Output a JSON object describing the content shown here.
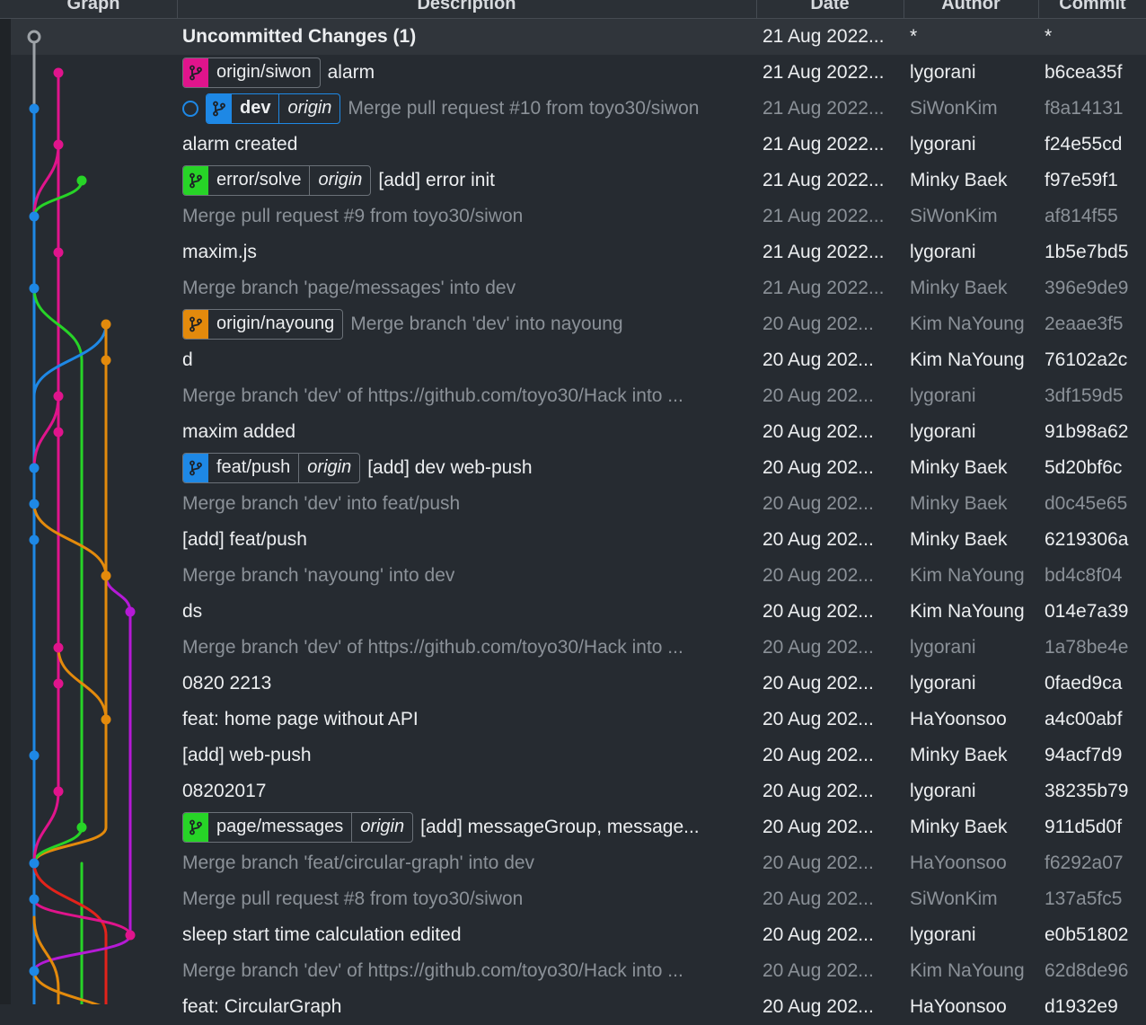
{
  "header": {
    "graph": "Graph",
    "description": "Description",
    "date": "Date",
    "author": "Author",
    "commit": "Commit"
  },
  "colors": {
    "blue": "#1e88e5",
    "magenta": "#e0148c",
    "green": "#27d427",
    "orange": "#e38a0c",
    "purple": "#b51ad6",
    "red": "#e3231b",
    "gray": "#9ea3a8"
  },
  "icons": {
    "branch": "branch-icon",
    "head_indicator": "head-indicator-icon"
  },
  "rows": [
    {
      "description": "Uncommitted Changes (1)",
      "date": "21 Aug 2022...",
      "author": "*",
      "commit": "*"
    },
    {
      "description": "alarm",
      "date": "21 Aug 2022...",
      "author": "lygorani",
      "commit": "b6cea35f",
      "tag": {
        "name": "origin/siwon",
        "color": "#e0148c"
      }
    },
    {
      "description": "Merge pull request #10 from toyo30/siwon",
      "date": "21 Aug 2022...",
      "author": "SiWonKim",
      "commit": "f8a14131",
      "tag": {
        "name": "dev",
        "remote": "origin",
        "color": "#1e88e5"
      }
    },
    {
      "description": "alarm created",
      "date": "21 Aug 2022...",
      "author": "lygorani",
      "commit": "f24e55cd"
    },
    {
      "description": "[add] error init",
      "date": "21 Aug 2022...",
      "author": "Minky Baek",
      "commit": "f97e59f1",
      "tag": {
        "name": "error/solve",
        "remote": "origin",
        "color": "#27d427"
      }
    },
    {
      "description": "Merge pull request #9 from toyo30/siwon",
      "date": "21 Aug 2022...",
      "author": "SiWonKim",
      "commit": "af814f55"
    },
    {
      "description": "maxim.js",
      "date": "21 Aug 2022...",
      "author": "lygorani",
      "commit": "1b5e7bd5"
    },
    {
      "description": "Merge branch 'page/messages' into dev",
      "date": "21 Aug 2022...",
      "author": "Minky Baek",
      "commit": "396e9de9"
    },
    {
      "description": "Merge branch 'dev' into nayoung",
      "date": "20 Aug 202...",
      "author": "Kim NaYoung",
      "commit": "2eaae3f5",
      "tag": {
        "name": "origin/nayoung",
        "color": "#e38a0c"
      }
    },
    {
      "description": "d",
      "date": "20 Aug 202...",
      "author": "Kim NaYoung",
      "commit": "76102a2c"
    },
    {
      "description": "Merge branch 'dev' of https://github.com/toyo30/Hack into ...",
      "date": "20 Aug 202...",
      "author": "lygorani",
      "commit": "3df159d5"
    },
    {
      "description": "maxim added",
      "date": "20 Aug 202...",
      "author": "lygorani",
      "commit": "91b98a62"
    },
    {
      "description": "[add] dev web-push",
      "date": "20 Aug 202...",
      "author": "Minky Baek",
      "commit": "5d20bf6c",
      "tag": {
        "name": "feat/push",
        "remote": "origin",
        "color": "#1e88e5"
      }
    },
    {
      "description": "Merge branch 'dev' into feat/push",
      "date": "20 Aug 202...",
      "author": "Minky Baek",
      "commit": "d0c45e65"
    },
    {
      "description": "[add] feat/push",
      "date": "20 Aug 202...",
      "author": "Minky Baek",
      "commit": "6219306a"
    },
    {
      "description": "Merge branch 'nayoung' into dev",
      "date": "20 Aug 202...",
      "author": "Kim NaYoung",
      "commit": "bd4c8f04"
    },
    {
      "description": "ds",
      "date": "20 Aug 202...",
      "author": "Kim NaYoung",
      "commit": "014e7a39"
    },
    {
      "description": "Merge branch 'dev' of https://github.com/toyo30/Hack into ...",
      "date": "20 Aug 202...",
      "author": "lygorani",
      "commit": "1a78be4e"
    },
    {
      "description": "0820 2213",
      "date": "20 Aug 202...",
      "author": "lygorani",
      "commit": "0faed9ca"
    },
    {
      "description": "feat: home page without API",
      "date": "20 Aug 202...",
      "author": "HaYoonsoo",
      "commit": "a4c00abf"
    },
    {
      "description": "[add] web-push",
      "date": "20 Aug 202...",
      "author": "Minky Baek",
      "commit": "94acf7d9"
    },
    {
      "description": "08202017",
      "date": "20 Aug 202...",
      "author": "lygorani",
      "commit": "38235b79"
    },
    {
      "description": "[add] messageGroup, message...",
      "date": "20 Aug 202...",
      "author": "Minky Baek",
      "commit": "911d5d0f",
      "tag": {
        "name": "page/messages",
        "remote": "origin",
        "color": "#27d427"
      }
    },
    {
      "description": "Merge branch 'feat/circular-graph' into dev",
      "date": "20 Aug 202...",
      "author": "HaYoonsoo",
      "commit": "f6292a07"
    },
    {
      "description": "Merge pull request #8 from toyo30/siwon",
      "date": "20 Aug 202...",
      "author": "SiWonKim",
      "commit": "137a5fc5"
    },
    {
      "description": "sleep start time calculation edited",
      "date": "20 Aug 202...",
      "author": "lygorani",
      "commit": "e0b51802"
    },
    {
      "description": "Merge branch 'dev' of https://github.com/toyo30/Hack into ...",
      "date": "20 Aug 202...",
      "author": "Kim NaYoung",
      "commit": "62d8de96"
    },
    {
      "description": "feat: CircularGraph",
      "date": "20 Aug 202...",
      "author": "HaYoonsoo",
      "commit": "d1932e9"
    }
  ]
}
